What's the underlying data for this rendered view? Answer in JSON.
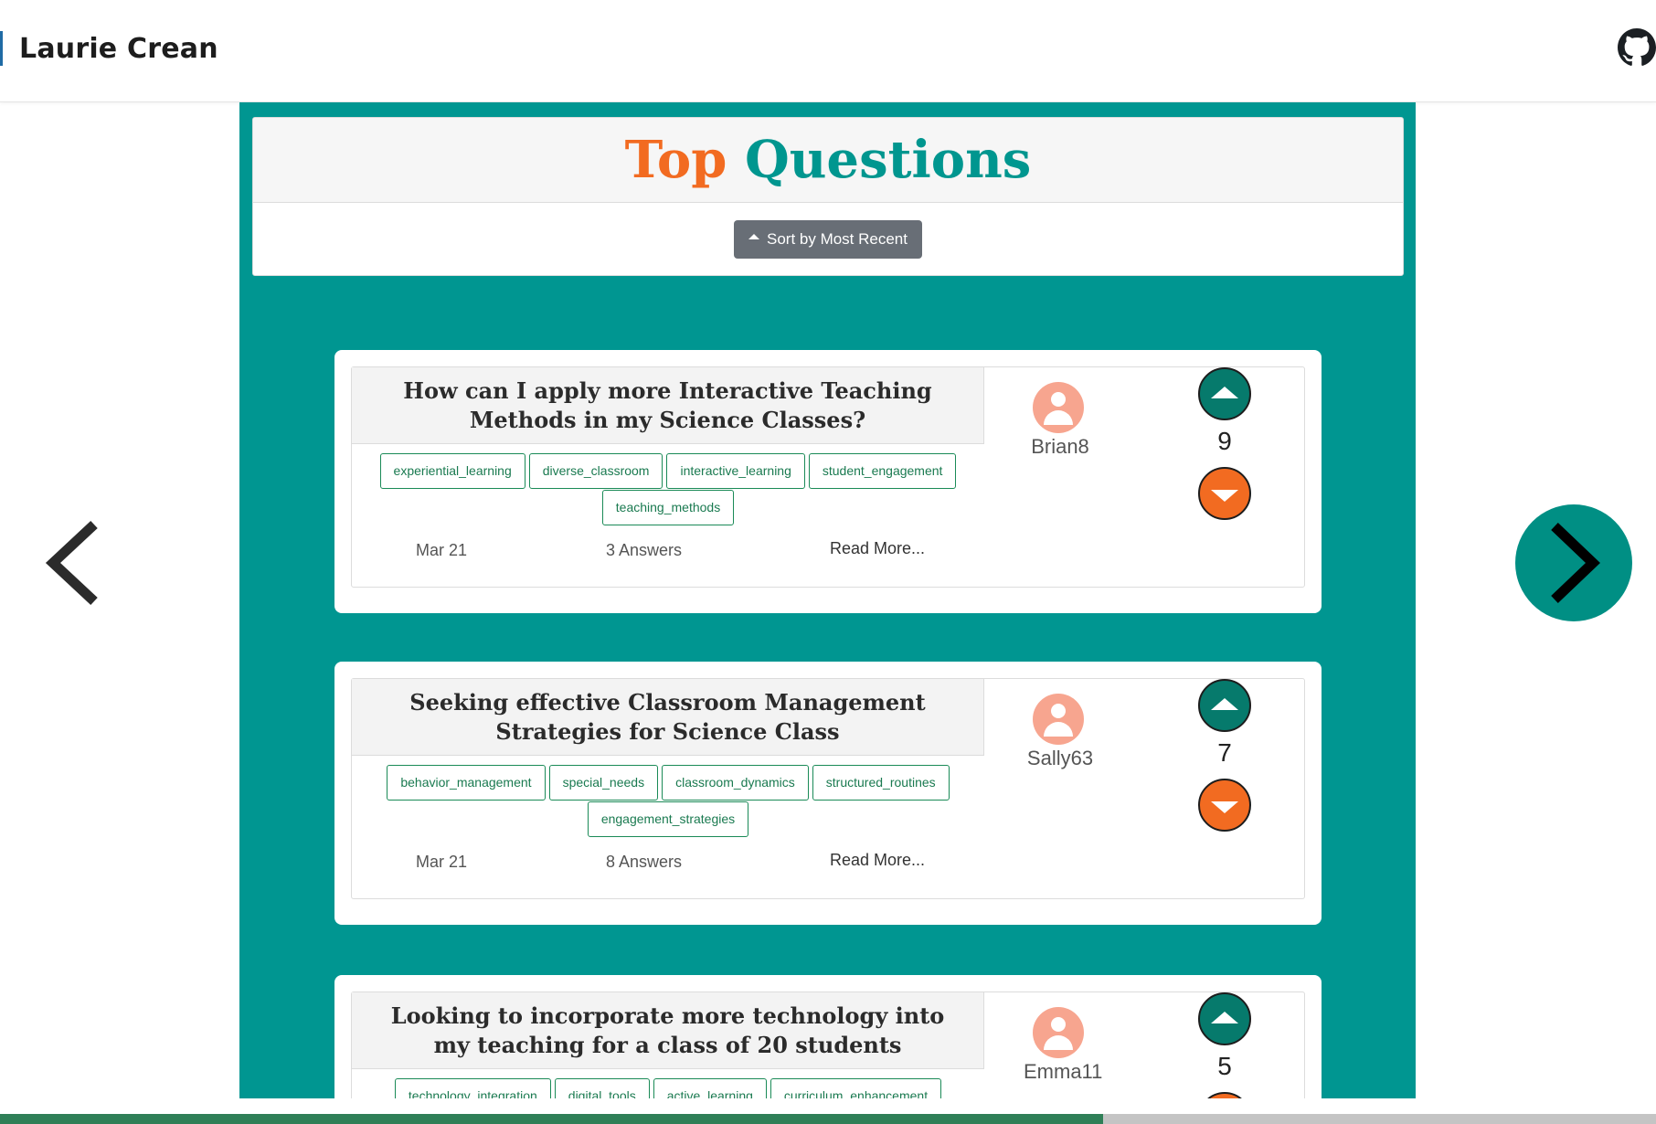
{
  "header": {
    "brand": "Laurie Crean",
    "github_icon": "github-icon"
  },
  "page": {
    "title_part1": "Top",
    "title_part2": "Questions",
    "sort_label": "Sort by Most Recent",
    "progress_fraction": 0.666
  },
  "colors": {
    "panel": "#009691",
    "accent_orange": "#f26b21",
    "accent_teal": "#00968f",
    "tag_green": "#1a7a50",
    "vote_up": "#067a6c",
    "vote_down": "#f26b21",
    "avatar": "#f7a58f"
  },
  "questions": [
    {
      "title": "How can I apply more Interactive Teaching Methods in my Science Classes?",
      "tags": [
        "experiential_learning",
        "diverse_classroom",
        "interactive_learning",
        "student_engagement",
        "teaching_methods"
      ],
      "date": "Mar 21",
      "answers": "3 Answers",
      "read_more": "Read More...",
      "user": "Brian8",
      "score": "9"
    },
    {
      "title": "Seeking effective Classroom Management Strategies for Science Class",
      "tags": [
        "behavior_management",
        "special_needs",
        "classroom_dynamics",
        "structured_routines",
        "engagement_strategies"
      ],
      "date": "Mar 21",
      "answers": "8 Answers",
      "read_more": "Read More...",
      "user": "Sally63",
      "score": "7"
    },
    {
      "title": "Looking to incorporate more technology into my teaching for a class of 20 students",
      "tags": [
        "technology_integration",
        "digital_tools",
        "active_learning",
        "curriculum_enhancement"
      ],
      "date": "",
      "answers": "",
      "read_more": "",
      "user": "Emma11",
      "score": "5"
    }
  ]
}
